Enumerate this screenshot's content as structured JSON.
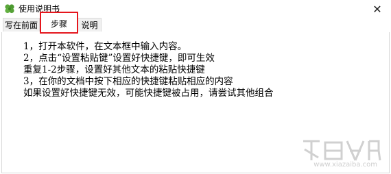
{
  "window": {
    "title": "使用说明书",
    "close_glyph": "✕"
  },
  "tabs": [
    {
      "label": "写在前面"
    },
    {
      "label": "步骤"
    },
    {
      "label": "说明"
    }
  ],
  "content": {
    "lines": [
      "1，打开本软件，在文本框中输入内容。",
      "2，点击“设置粘贴键”设置好快捷键，即可生效",
      "重复1-2步骤，设置好其他文本的粘贴快捷键",
      "3，在你的文档中按下相应的快捷键粘贴相应的内容",
      "  如果设置好快捷键无效，可能快捷键被占用，请尝试其他组合"
    ]
  },
  "watermark": {
    "text": "www.xiazaiba.com"
  }
}
